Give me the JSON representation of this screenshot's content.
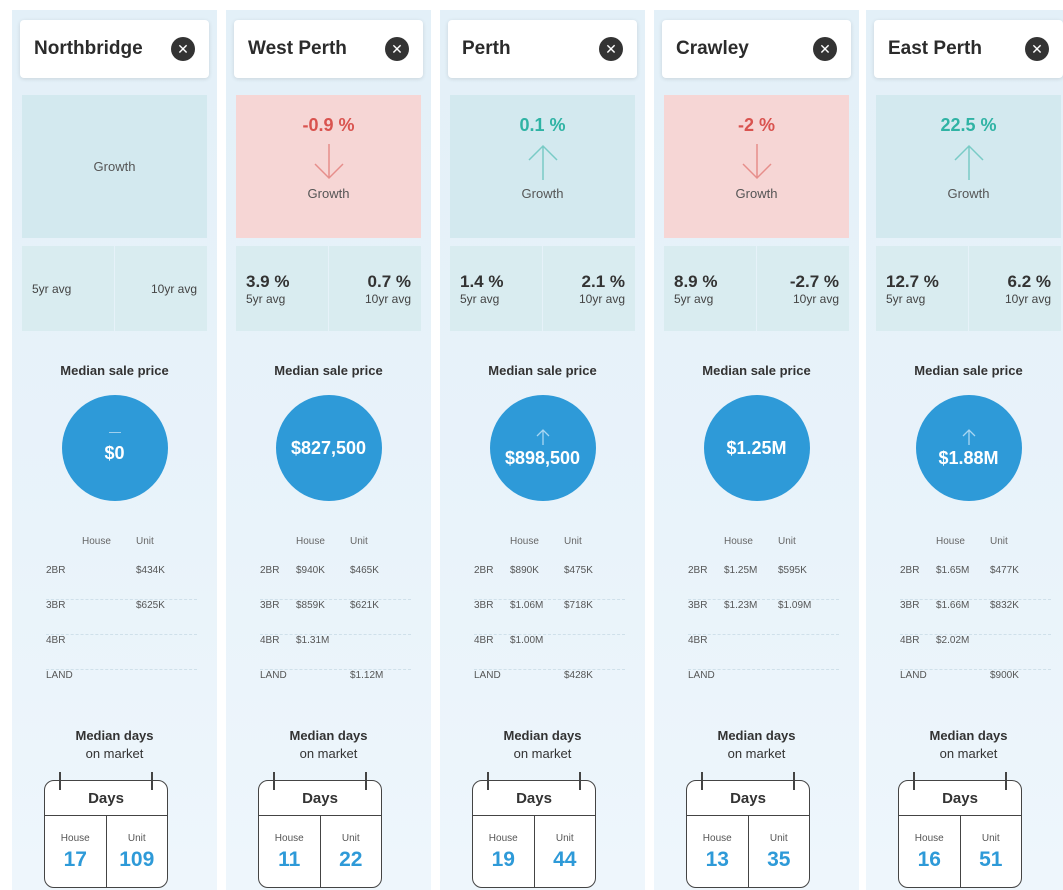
{
  "columns": [
    {
      "name": "Northbridge",
      "close": "✕",
      "growth": {
        "value": "",
        "trend": "none",
        "label": "Growth"
      },
      "avg5": {
        "value": "",
        "label": "5yr avg"
      },
      "avg10": {
        "value": "",
        "label": "10yr avg"
      },
      "price_title": "Median sale price",
      "price": {
        "value": "$0",
        "trend": "none"
      },
      "table": {
        "headers": [
          "",
          "House",
          "Unit"
        ],
        "rows": [
          [
            "2BR",
            "",
            "$434K"
          ],
          [
            "3BR",
            "",
            "$625K"
          ],
          [
            "4BR",
            "",
            ""
          ],
          [
            "LAND",
            "",
            ""
          ]
        ]
      },
      "days": {
        "title1": "Median days",
        "title2": "on market",
        "heading": "Days",
        "house_label": "House",
        "unit_label": "Unit",
        "house": "17",
        "unit": "109"
      }
    },
    {
      "name": "West Perth",
      "close": "✕",
      "growth": {
        "value": "-0.9 %",
        "trend": "down",
        "label": "Growth"
      },
      "avg5": {
        "value": "3.9 %",
        "label": "5yr avg"
      },
      "avg10": {
        "value": "0.7 %",
        "label": "10yr avg"
      },
      "price_title": "Median sale price",
      "price": {
        "value": "$827,500",
        "trend": "flat"
      },
      "table": {
        "headers": [
          "",
          "House",
          "Unit"
        ],
        "rows": [
          [
            "2BR",
            "$940K",
            "$465K"
          ],
          [
            "3BR",
            "$859K",
            "$621K"
          ],
          [
            "4BR",
            "$1.31M",
            ""
          ],
          [
            "LAND",
            "",
            "$1.12M"
          ]
        ]
      },
      "days": {
        "title1": "Median days",
        "title2": "on market",
        "heading": "Days",
        "house_label": "House",
        "unit_label": "Unit",
        "house": "11",
        "unit": "22"
      }
    },
    {
      "name": "Perth",
      "close": "✕",
      "growth": {
        "value": "0.1 %",
        "trend": "up",
        "label": "Growth"
      },
      "avg5": {
        "value": "1.4 %",
        "label": "5yr avg"
      },
      "avg10": {
        "value": "2.1 %",
        "label": "10yr avg"
      },
      "price_title": "Median sale price",
      "price": {
        "value": "$898,500",
        "trend": "up"
      },
      "table": {
        "headers": [
          "",
          "House",
          "Unit"
        ],
        "rows": [
          [
            "2BR",
            "$890K",
            "$475K"
          ],
          [
            "3BR",
            "$1.06M",
            "$718K"
          ],
          [
            "4BR",
            "$1.00M",
            ""
          ],
          [
            "LAND",
            "",
            "$428K"
          ]
        ]
      },
      "days": {
        "title1": "Median days",
        "title2": "on market",
        "heading": "Days",
        "house_label": "House",
        "unit_label": "Unit",
        "house": "19",
        "unit": "44"
      }
    },
    {
      "name": "Crawley",
      "close": "✕",
      "growth": {
        "value": "-2 %",
        "trend": "down",
        "label": "Growth"
      },
      "avg5": {
        "value": "8.9 %",
        "label": "5yr avg"
      },
      "avg10": {
        "value": "-2.7 %",
        "label": "10yr avg"
      },
      "price_title": "Median sale price",
      "price": {
        "value": "$1.25M",
        "trend": "flat"
      },
      "table": {
        "headers": [
          "",
          "House",
          "Unit"
        ],
        "rows": [
          [
            "2BR",
            "$1.25M",
            "$595K"
          ],
          [
            "3BR",
            "$1.23M",
            "$1.09M"
          ],
          [
            "4BR",
            "",
            ""
          ],
          [
            "LAND",
            "",
            ""
          ]
        ]
      },
      "days": {
        "title1": "Median days",
        "title2": "on market",
        "heading": "Days",
        "house_label": "House",
        "unit_label": "Unit",
        "house": "13",
        "unit": "35"
      }
    },
    {
      "name": "East Perth",
      "close": "✕",
      "growth": {
        "value": "22.5 %",
        "trend": "up",
        "label": "Growth"
      },
      "avg5": {
        "value": "12.7 %",
        "label": "5yr avg"
      },
      "avg10": {
        "value": "6.2 %",
        "label": "10yr avg"
      },
      "price_title": "Median sale price",
      "price": {
        "value": "$1.88M",
        "trend": "up"
      },
      "table": {
        "headers": [
          "",
          "House",
          "Unit"
        ],
        "rows": [
          [
            "2BR",
            "$1.65M",
            "$477K"
          ],
          [
            "3BR",
            "$1.66M",
            "$832K"
          ],
          [
            "4BR",
            "$2.02M",
            ""
          ],
          [
            "LAND",
            "",
            "$900K"
          ]
        ]
      },
      "days": {
        "title1": "Median days",
        "title2": "on market",
        "heading": "Days",
        "house_label": "House",
        "unit_label": "Unit",
        "house": "16",
        "unit": "51"
      }
    }
  ],
  "colors": {
    "positive": "#2fb3a4",
    "negative": "#d9534f",
    "accent": "#2e9ad8"
  }
}
